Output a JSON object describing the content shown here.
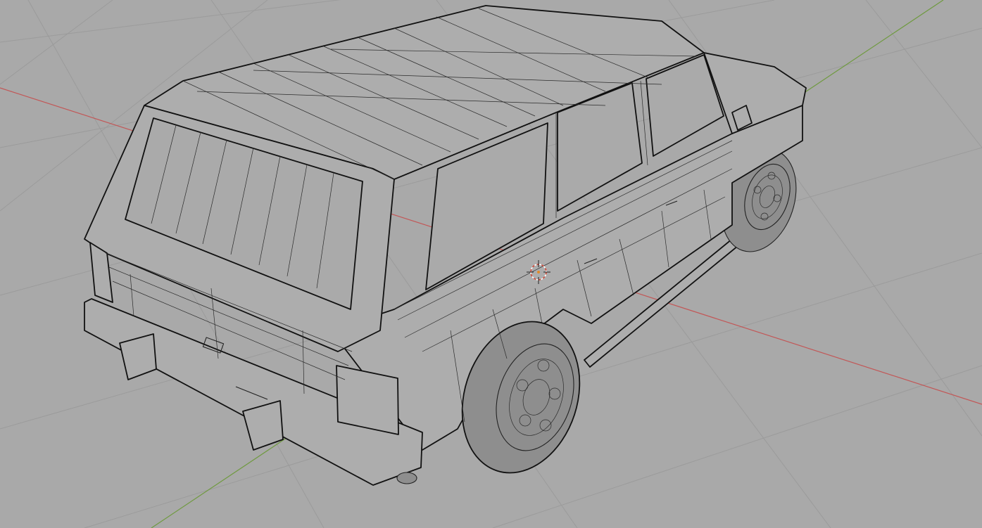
{
  "app": {
    "view": "3D viewport",
    "shading": "wireframe"
  },
  "colors": {
    "background": "#a9a9a9",
    "grid": "#9b9b9b",
    "x_axis": "#c25757",
    "y_axis": "#6f9a3f",
    "wire": "#222222",
    "cursor_ring": "#d24b3a"
  },
  "scene": {
    "object": "suv-wireframe-model",
    "cursor_icon": "3d-cursor-icon"
  }
}
